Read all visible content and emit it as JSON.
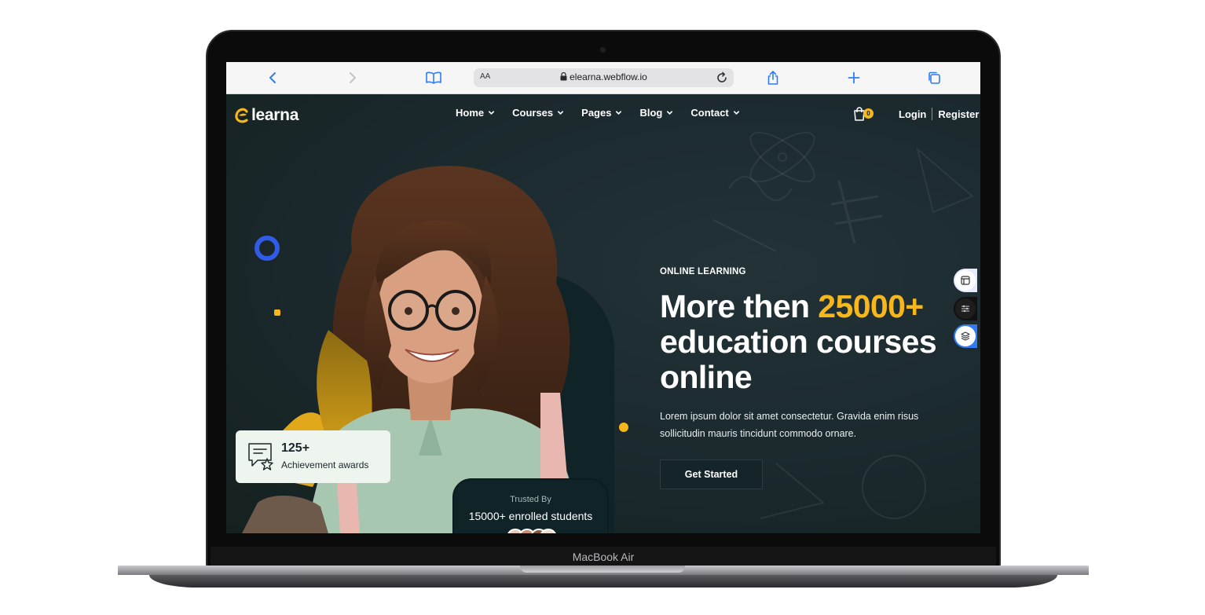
{
  "device": {
    "brand_label": "MacBook Air"
  },
  "browser": {
    "aa_label": "AA",
    "url": "elearna.webflow.io",
    "icons": [
      "back-icon",
      "forward-icon",
      "bookmarks-icon",
      "lock-icon",
      "reload-icon",
      "share-icon",
      "new-tab-icon",
      "tabs-icon"
    ]
  },
  "site": {
    "logo_text": "learna",
    "nav": [
      {
        "label": "Home"
      },
      {
        "label": "Courses"
      },
      {
        "label": "Pages"
      },
      {
        "label": "Blog"
      },
      {
        "label": "Contact"
      }
    ],
    "cart_count": "0",
    "login_label": "Login",
    "register_label": "Register"
  },
  "hero": {
    "eyebrow": "ONLINE LEARNING",
    "headline_part1": "More then ",
    "headline_accent": "25000+",
    "headline_part2": "education courses online",
    "description": "Lorem ipsum dolor sit amet consectetur. Gravida enim risus sollicitudin mauris tincidunt commodo ornare.",
    "cta_label": "Get Started",
    "award_number": "125+",
    "award_label": "Achievement awards",
    "trusted_label": "Trusted By",
    "enrolled_label": "15000+ enrolled students"
  },
  "colors": {
    "accent_yellow": "#f5b71c",
    "accent_blue": "#2f5be6",
    "hero_bg": "#1c2b30",
    "card_bg": "#eef5ee",
    "browser_blue": "#2f7cf6"
  }
}
